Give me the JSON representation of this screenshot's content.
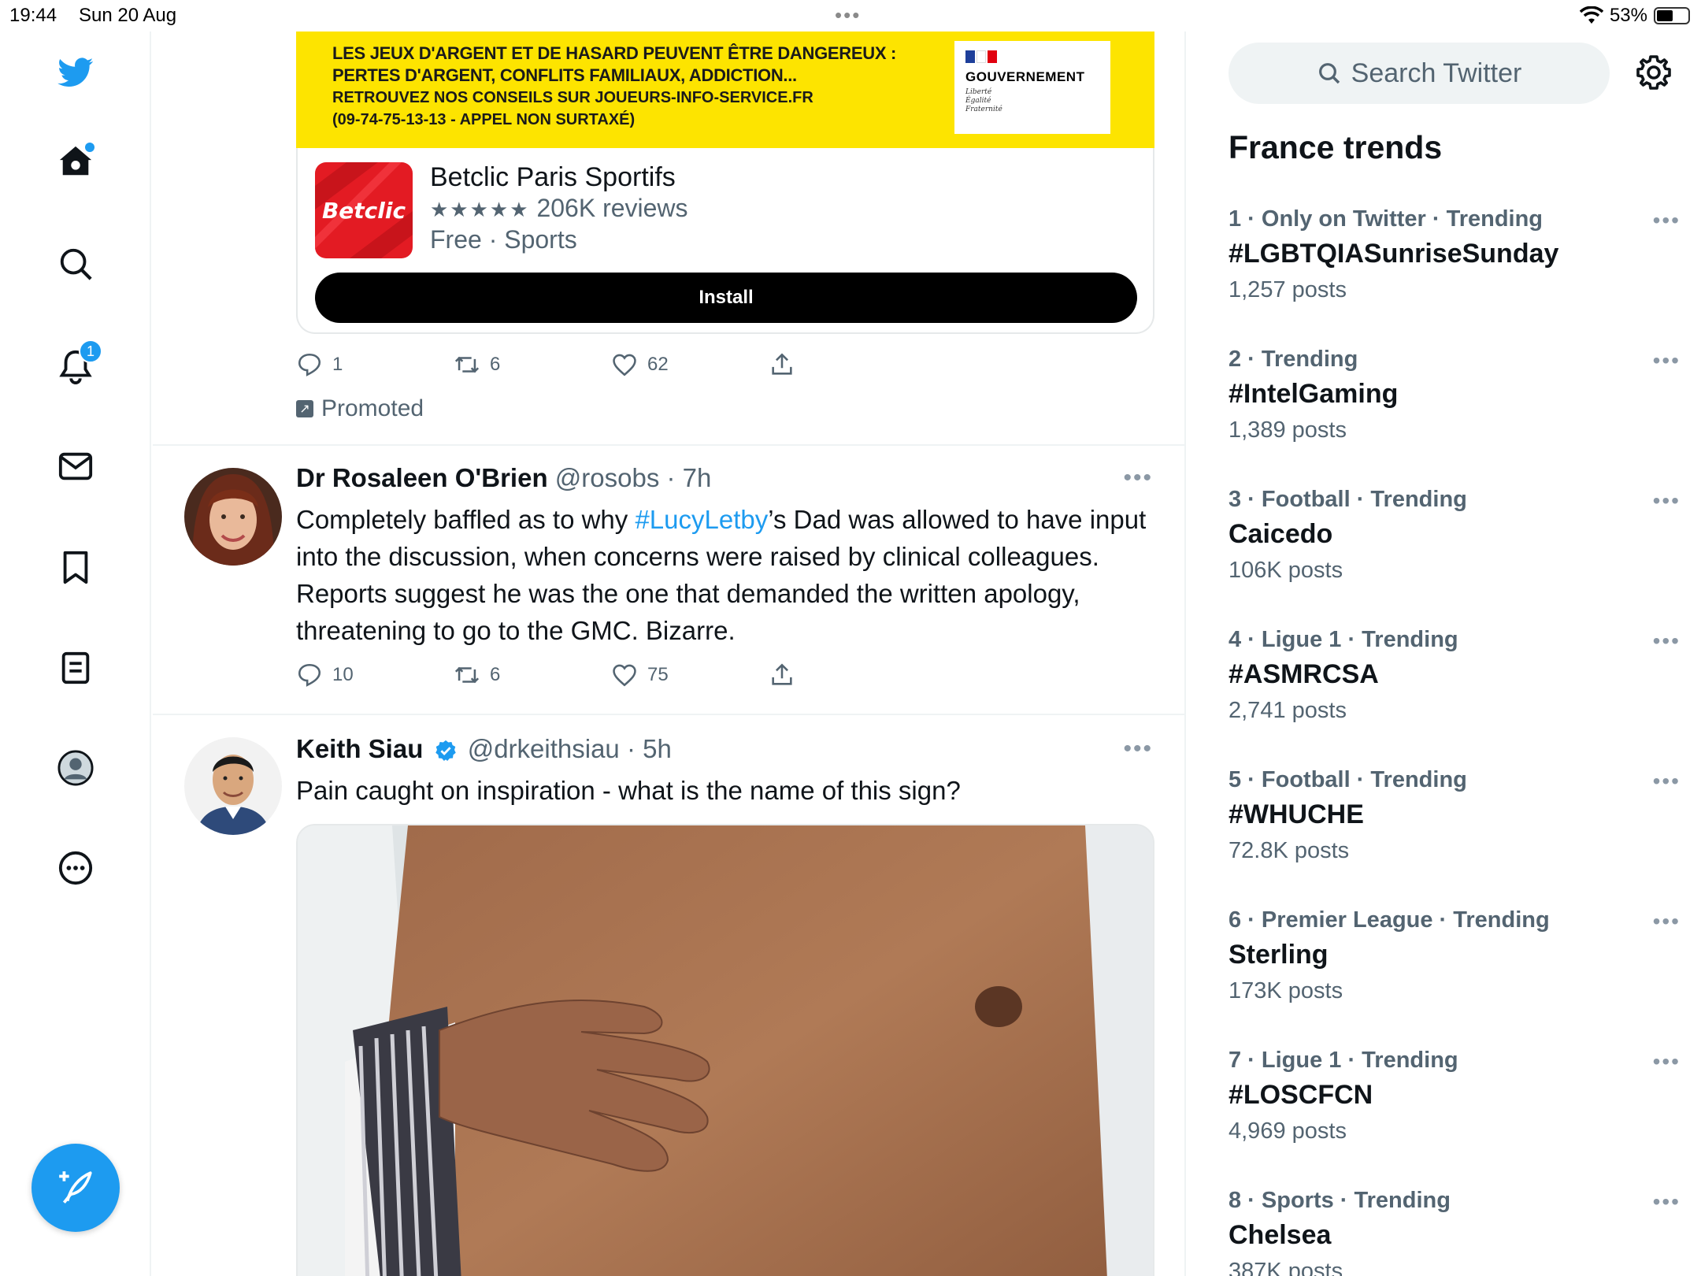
{
  "status_bar": {
    "time": "19:44",
    "date": "Sun 20 Aug",
    "battery": "53%",
    "battery_level": 0.53
  },
  "ad": {
    "banner_line1": "LES JEUX D'ARGENT ET DE HASARD PEUVENT ÊTRE DANGEREUX :",
    "banner_line2": "PERTES D'ARGENT, CONFLITS FAMILIAUX, ADDICTION...",
    "banner_line3": "RETROUVEZ NOS CONSEILS SUR JOUEURS-INFO-SERVICE.FR",
    "banner_line4": "(09-74-75-13-13 - APPEL NON SURTAXÉ)",
    "gov_name": "GOUVERNEMENT",
    "gov_motto1": "Liberté",
    "gov_motto2": "Égalité",
    "gov_motto3": "Fraternité",
    "app_logo_text": "Betclic",
    "app_name": "Betclic Paris Sportifs",
    "app_stars": "★★★★★",
    "app_reviews": "206K reviews",
    "app_meta": "Free · Sports",
    "install_label": "Install",
    "replies": "1",
    "retweets": "6",
    "likes": "62",
    "promoted_label": "Promoted"
  },
  "tweet1": {
    "name": "Dr Rosaleen O'Brien",
    "handle_time": "@rosobs · 7h",
    "text_before": "Completely baffled as to why ",
    "hashtag": "#LucyLetby",
    "text_after": "’s Dad was allowed to have input into the discussion, when concerns were raised by clinical colleagues. Reports suggest he was the one that demanded the written apology, threatening to go to the GMC. Bizarre.",
    "replies": "10",
    "retweets": "6",
    "likes": "75"
  },
  "tweet2": {
    "name": "Keith Siau",
    "handle_time": "@drkeithsiau · 5h",
    "text": "Pain caught on inspiration - what is the name of this sign?"
  },
  "sidebar": {
    "search_placeholder": "Search Twitter",
    "trends_title": "France trends",
    "trends": [
      {
        "context": "1 · Only on Twitter · Trending",
        "title": "#LGBTQIASunriseSunday",
        "count": "1,257 posts"
      },
      {
        "context": "2 · Trending",
        "title": "#IntelGaming",
        "count": "1,389 posts"
      },
      {
        "context": "3 · Football · Trending",
        "title": "Caicedo",
        "count": "106K posts"
      },
      {
        "context": "4 · Ligue 1 · Trending",
        "title": "#ASMRCSA",
        "count": "2,741 posts"
      },
      {
        "context": "5 · Football · Trending",
        "title": "#WHUCHE",
        "count": "72.8K posts"
      },
      {
        "context": "6 · Premier League · Trending",
        "title": "Sterling",
        "count": "173K posts"
      },
      {
        "context": "7 · Ligue 1 · Trending",
        "title": "#LOSCFCN",
        "count": "4,969 posts"
      },
      {
        "context": "8 · Sports · Trending",
        "title": "Chelsea",
        "count": "387K posts"
      }
    ]
  },
  "nav": {
    "notifications_badge": "1"
  },
  "colors": {
    "accent": "#1d9bf0",
    "ad_banner": "#fde400",
    "betclic_red": "#e31b23"
  }
}
